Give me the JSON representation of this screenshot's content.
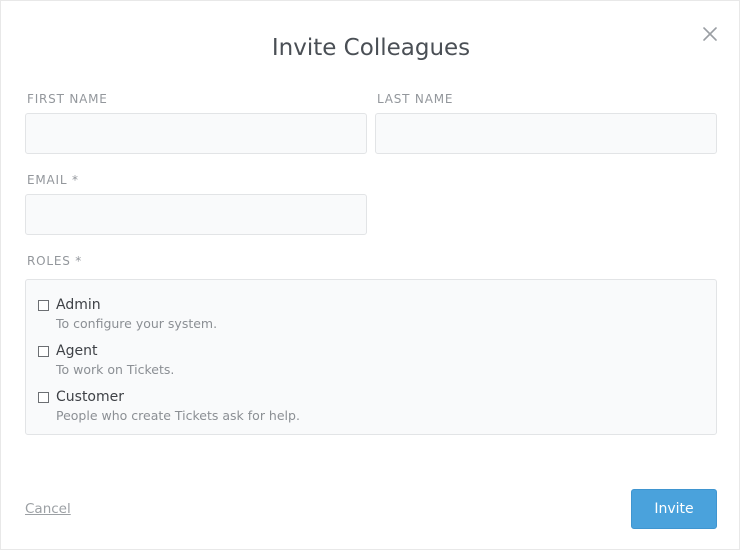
{
  "dialog": {
    "title": "Invite Colleagues",
    "close_icon": "close-icon"
  },
  "form": {
    "first_name": {
      "label": "FIRST NAME",
      "value": "",
      "placeholder": ""
    },
    "last_name": {
      "label": "LAST NAME",
      "value": "",
      "placeholder": ""
    },
    "email": {
      "label": "EMAIL *",
      "value": "",
      "placeholder": ""
    },
    "roles_label": "ROLES *",
    "roles": [
      {
        "name": "Admin",
        "description": "To configure your system.",
        "checked": false
      },
      {
        "name": "Agent",
        "description": "To work on Tickets.",
        "checked": false
      },
      {
        "name": "Customer",
        "description": "People who create Tickets ask for help.",
        "checked": false
      }
    ]
  },
  "actions": {
    "cancel_label": "Cancel",
    "invite_label": "Invite"
  },
  "colors": {
    "primary_button": "#4aa2dc",
    "text": "#4a4f55",
    "muted": "#93979c",
    "field_bg": "#f9fafb",
    "field_border": "#e2e4e6"
  }
}
